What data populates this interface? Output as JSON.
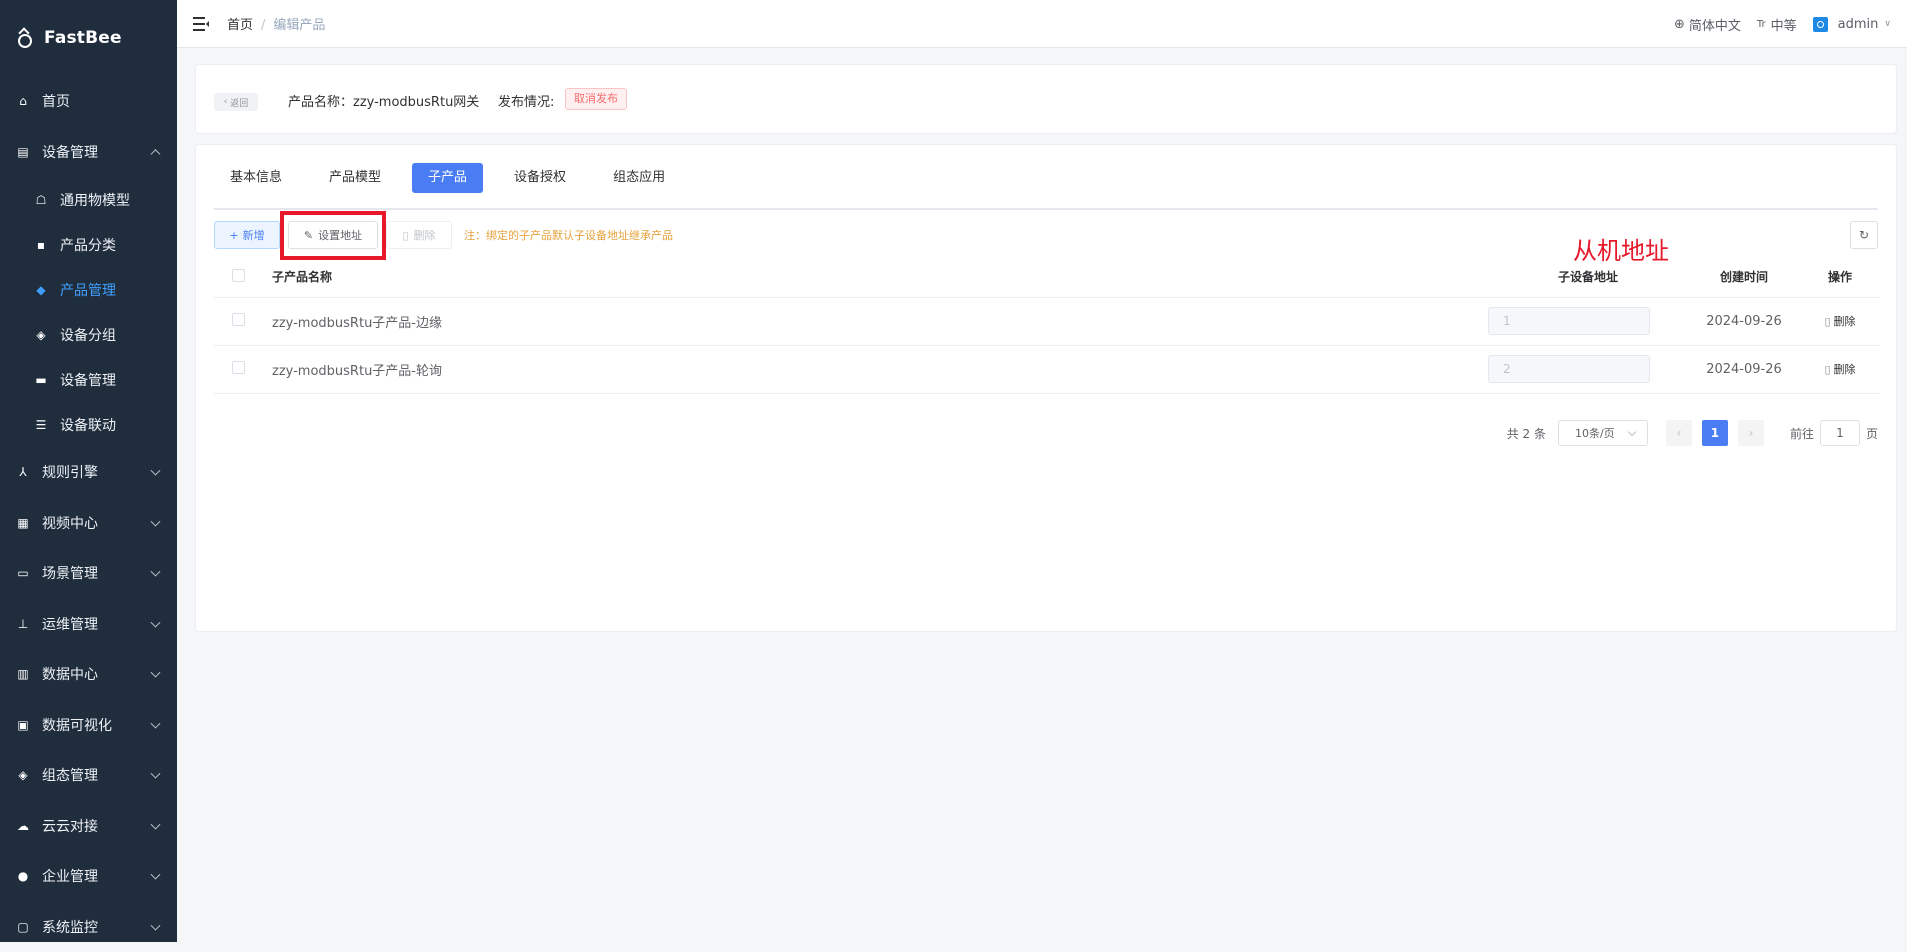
{
  "app": {
    "name": "FastBee"
  },
  "sidebar": {
    "items": [
      {
        "label": "首页",
        "icon": "home-icon",
        "expandable": false
      },
      {
        "label": "设备管理",
        "icon": "device-icon",
        "expandable": true,
        "expanded": true,
        "children": [
          {
            "label": "通用物模型",
            "icon": "model-icon"
          },
          {
            "label": "产品分类",
            "icon": "category-icon"
          },
          {
            "label": "产品管理",
            "icon": "product-icon",
            "active": true
          },
          {
            "label": "设备分组",
            "icon": "group-icon"
          },
          {
            "label": "设备管理",
            "icon": "device-manage-icon"
          },
          {
            "label": "设备联动",
            "icon": "linkage-icon"
          }
        ]
      },
      {
        "label": "规则引擎",
        "icon": "rule-icon",
        "expandable": true
      },
      {
        "label": "视频中心",
        "icon": "video-icon",
        "expandable": true
      },
      {
        "label": "场景管理",
        "icon": "scene-icon",
        "expandable": true
      },
      {
        "label": "运维管理",
        "icon": "ops-icon",
        "expandable": true
      },
      {
        "label": "数据中心",
        "icon": "data-icon",
        "expandable": true
      },
      {
        "label": "数据可视化",
        "icon": "visual-icon",
        "expandable": true
      },
      {
        "label": "组态管理",
        "icon": "config-icon",
        "expandable": true
      },
      {
        "label": "云云对接",
        "icon": "cloud-icon",
        "expandable": true
      },
      {
        "label": "企业管理",
        "icon": "enterprise-icon",
        "expandable": true
      },
      {
        "label": "系统监控",
        "icon": "monitor-icon",
        "expandable": true
      }
    ]
  },
  "header": {
    "breadcrumb": {
      "home": "首页",
      "separator": "/",
      "current": "编辑产品"
    },
    "language": "简体中文",
    "font_size": "中等",
    "user": "admin"
  },
  "product_bar": {
    "back_label": "返回",
    "product_name": "产品名称：zzy-modbusRtu网关",
    "publish_label": "发布情况:",
    "publish_tag": "取消发布"
  },
  "tabs": [
    "基本信息",
    "产品模型",
    "子产品",
    "设备授权",
    "组态应用"
  ],
  "active_tab": 2,
  "toolbar": {
    "add_label": "新增",
    "set_address_label": "设置地址",
    "delete_label": "删除",
    "note": "注：绑定的子产品默认子设备地址继承产品"
  },
  "annotation": {
    "text": "从机地址",
    "color": "#e8182b"
  },
  "table": {
    "headers": {
      "name": "子产品名称",
      "address": "子设备地址",
      "created": "创建时间",
      "action": "操作"
    },
    "rows": [
      {
        "name": "zzy-modbusRtu子产品-边缘",
        "address": "1",
        "created": "2024-09-26",
        "action": "删除"
      },
      {
        "name": "zzy-modbusRtu子产品-轮询",
        "address": "2",
        "created": "2024-09-26",
        "action": "删除"
      }
    ]
  },
  "pagination": {
    "total": "共 2 条",
    "page_size": "10条/页",
    "current_page": "1",
    "goto_label": "前往",
    "goto_value": "1",
    "page_suffix": "页"
  },
  "colors": {
    "sidebar_bg": "#1f2d3d",
    "accent": "#4a7cf4",
    "active_menu": "#409eff",
    "danger": "#f56c6c",
    "warning": "#e6a23c"
  }
}
